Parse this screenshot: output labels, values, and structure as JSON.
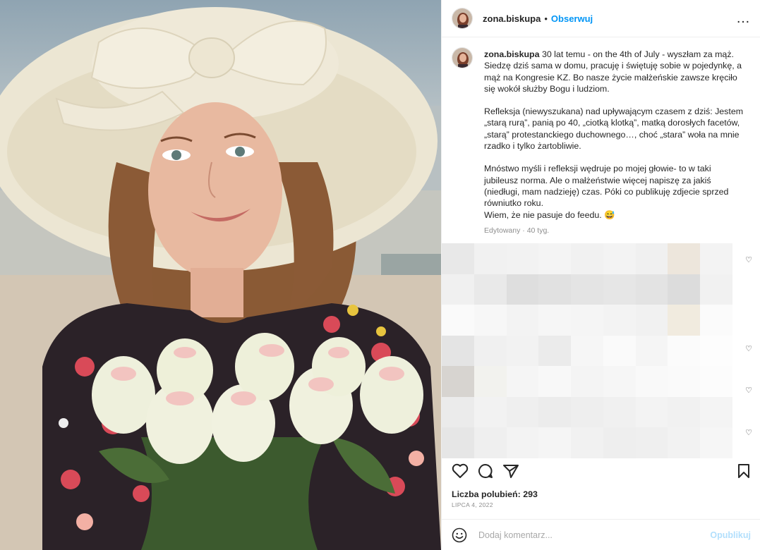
{
  "post": {
    "username": "zona.biskupa",
    "separator": "•",
    "follow_label": "Obserwuj",
    "more_icon": "…"
  },
  "caption": {
    "username": "zona.biskupa",
    "p1": "30 lat temu - on the 4th of July - wyszłam za mąż. Siedzę dziś sama w domu, pracuję i świętuję sobie w pojedynkę, a mąż na Kongresie KZ. Bo nasze życie małżeńskie zawsze kręciło się wokół służby Bogu i ludziom.",
    "p2": "Refleksja (niewyszukana) nad upływającym czasem z dziś: Jestem „starą rurą”, panią po 40, „ciotką klotką”, matką dorosłych facetów, „starą” protestanckiego duchownego…, choć „stara” woła na mnie rzadko i tylko żartobliwie.",
    "p3a": "Mnóstwo myśli i refleksji wędruje po mojej głowie- to w taki jubileusz norma. Ale o małżeństwie więcej napiszę za jakiś (niedługi, mam nadzieję) czas. Póki co publikuję zdjecie sprzed równiutko roku.",
    "p3b": "Wiem, że nie pasuje do feedu. 😅",
    "meta": "Edytowany · 40 tyg."
  },
  "actions": {
    "likes": "Liczba polubień: 293",
    "date": "LIPCA 4, 2022"
  },
  "comment_box": {
    "placeholder": "Dodaj komentarz...",
    "publish_label": "Opublikuj"
  }
}
